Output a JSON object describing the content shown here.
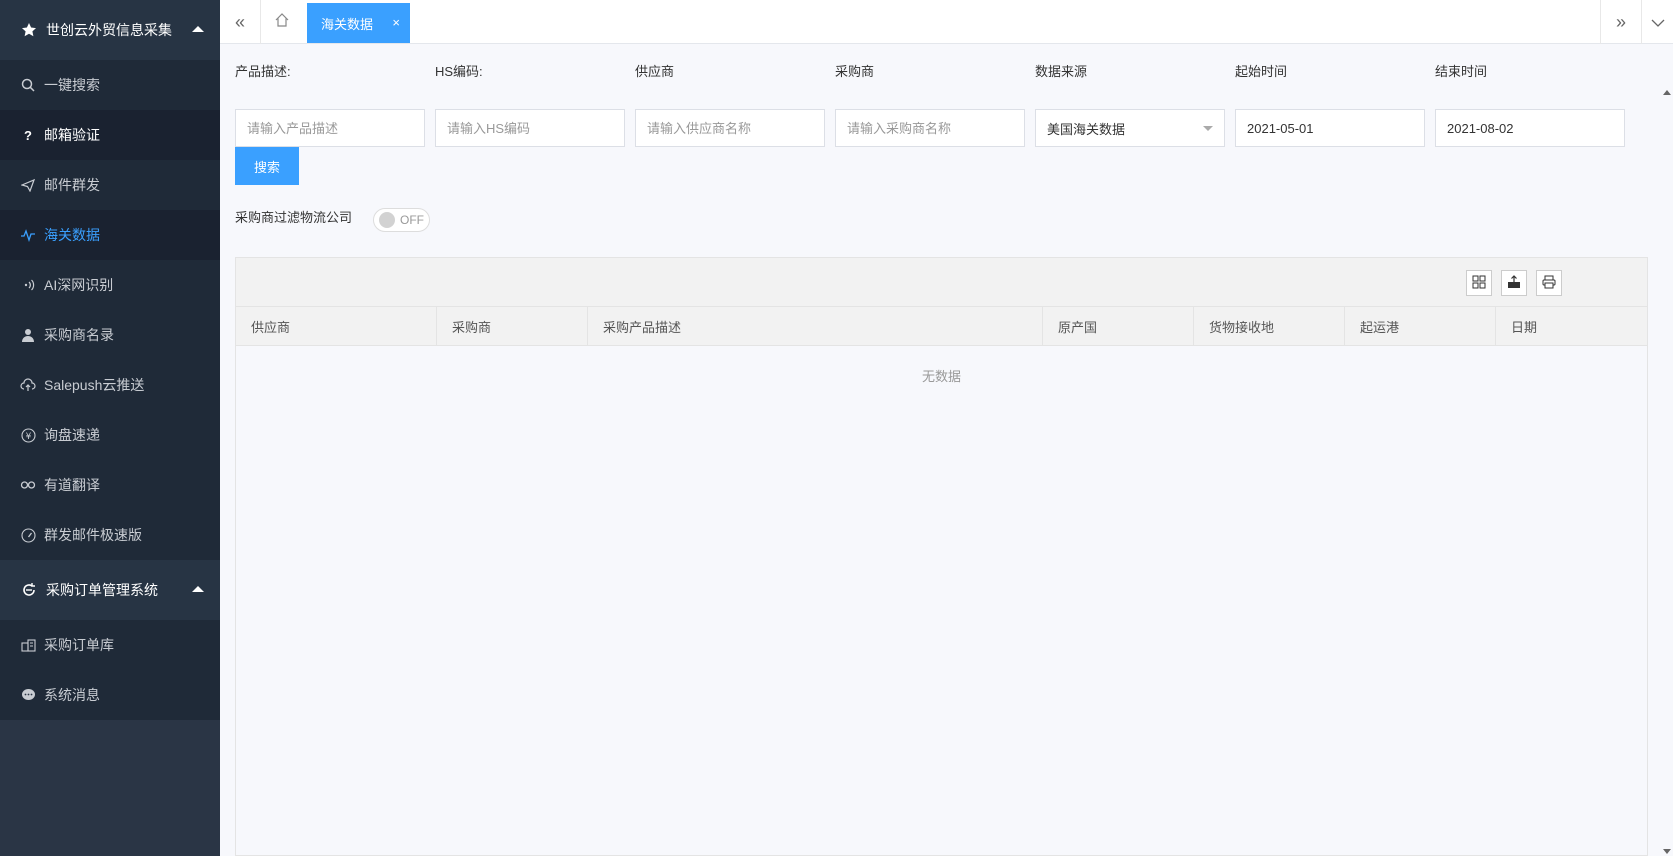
{
  "sidebar": {
    "group1": {
      "title": "世创云外贸信息采集",
      "items": [
        {
          "label": "一键搜索",
          "icon": "search-icon"
        },
        {
          "label": "邮箱验证",
          "icon": "question-icon"
        },
        {
          "label": "邮件群发",
          "icon": "send-icon"
        },
        {
          "label": "海关数据",
          "icon": "pulse-icon"
        },
        {
          "label": "AI深网识别",
          "icon": "signal-icon"
        },
        {
          "label": "采购商名录",
          "icon": "user-icon"
        },
        {
          "label": "Salepush云推送",
          "icon": "cloud-upload-icon"
        },
        {
          "label": "询盘速递",
          "icon": "yen-icon"
        },
        {
          "label": "有道翻译",
          "icon": "infinity-icon"
        },
        {
          "label": "群发邮件极速版",
          "icon": "speedometer-icon"
        }
      ]
    },
    "group2": {
      "title": "采购订单管理系统",
      "items": [
        {
          "label": "采购订单库",
          "icon": "buildings-icon"
        },
        {
          "label": "系统消息",
          "icon": "chat-icon"
        }
      ]
    }
  },
  "tabs": {
    "active": "海关数据",
    "close": "×"
  },
  "filters": {
    "labels": [
      "产品描述:",
      "HS编码:",
      "供应商",
      "采购商",
      "数据来源",
      "起始时间",
      "结束时间"
    ],
    "placeholders": [
      "请输入产品描述",
      "请输入HS编码",
      "请输入供应商名称",
      "请输入采购商名称"
    ],
    "data_source": "美国海关数据",
    "start_date": "2021-05-01",
    "end_date": "2021-08-02",
    "search_label": "搜索",
    "toggle_label": "采购商过滤物流公司",
    "toggle_state": "OFF"
  },
  "table": {
    "columns": [
      "供应商",
      "采购商",
      "采购产品描述",
      "原产国",
      "货物接收地",
      "起运港",
      "日期"
    ],
    "empty_text": "无数据"
  },
  "colors": {
    "accent": "#3aa0ff",
    "sidebar_bg": "#2a3545"
  }
}
